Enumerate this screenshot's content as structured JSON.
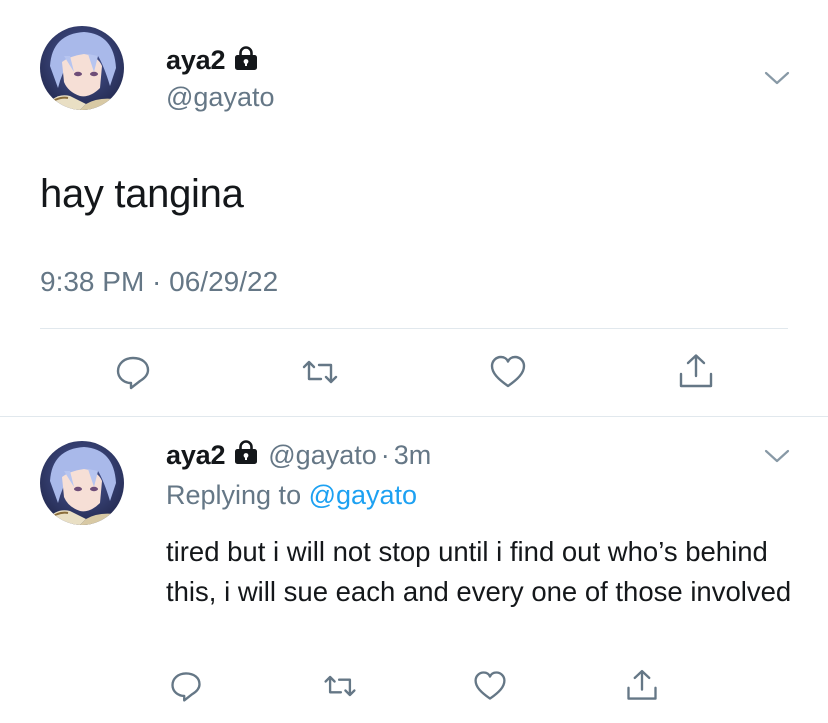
{
  "main_tweet": {
    "display_name": "aya2",
    "handle": "@gayato",
    "text": "hay tangina",
    "timestamp": "9:38 PM · 06/29/22",
    "protected": true
  },
  "reply_tweet": {
    "display_name": "aya2",
    "handle": "@gayato",
    "separator": "·",
    "time_ago": "3m",
    "replying_prefix": "Replying to ",
    "replying_mention": "@gayato",
    "text": "tired but i will not stop until i find out who’s behind this, i will sue each and every one of those involved",
    "protected": true
  },
  "actions": [
    "reply-icon",
    "retweet-icon",
    "like-icon",
    "share-icon"
  ],
  "colors": {
    "text_primary": "#14171a",
    "text_secondary": "#657786",
    "accent": "#1da1f2",
    "divider": "#e1e8ed"
  }
}
